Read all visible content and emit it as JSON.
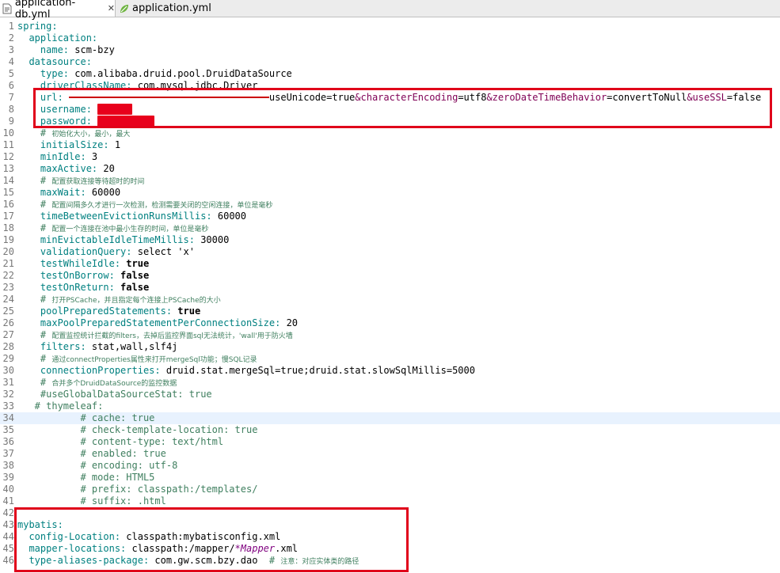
{
  "tabs": [
    {
      "label": "application-db.yml",
      "active": true,
      "closable": true,
      "icon": "yaml-file-icon"
    },
    {
      "label": "application.yml",
      "active": false,
      "icon": "spring-leaf-icon"
    }
  ],
  "lines": [
    {
      "n": "1",
      "tokens": [
        {
          "t": "spring:",
          "s": "k"
        }
      ]
    },
    {
      "n": "2",
      "tokens": [
        {
          "t": "  application:",
          "s": "k"
        }
      ]
    },
    {
      "n": "3",
      "tokens": [
        {
          "t": "    name: ",
          "s": "k"
        },
        {
          "t": "scm-bzy",
          "s": "v"
        }
      ]
    },
    {
      "n": "4",
      "tokens": [
        {
          "t": "  datasource:",
          "s": "k"
        }
      ]
    },
    {
      "n": "5",
      "tokens": [
        {
          "t": "    type: ",
          "s": "k"
        },
        {
          "t": "com.alibaba.druid.pool.DruidDataSource",
          "s": "v"
        }
      ]
    },
    {
      "n": "6",
      "tokens": [
        {
          "t": "    driverClassName: ",
          "s": "k"
        },
        {
          "t": "com.mysql.jdbc.Driver",
          "s": "v"
        }
      ]
    },
    {
      "n": "7",
      "tokens": [
        {
          "t": "    url: ",
          "s": "k"
        },
        {
          "t": "jdbc:mysql://xxxxxxxxxxxxxxxxxxxxx?",
          "s": "redactline"
        },
        {
          "t": "useUnicode=true",
          "s": "v"
        },
        {
          "t": "&characterEncoding",
          "s": "p"
        },
        {
          "t": "=utf8",
          "s": "v"
        },
        {
          "t": "&zeroDateTimeBehavior",
          "s": "p"
        },
        {
          "t": "=convertToNull",
          "s": "v"
        },
        {
          "t": "&useSSL",
          "s": "p"
        },
        {
          "t": "=false",
          "s": "v"
        }
      ]
    },
    {
      "n": "8",
      "tokens": [
        {
          "t": "    username: ",
          "s": "k"
        },
        {
          "t": "xxxxxx",
          "s": "redact"
        }
      ]
    },
    {
      "n": "9",
      "tokens": [
        {
          "t": "    password: ",
          "s": "k"
        },
        {
          "t": "xxxxxxxxxx",
          "s": "redact"
        }
      ]
    },
    {
      "n": "10",
      "tokens": [
        {
          "t": "    # ",
          "s": "c"
        },
        {
          "t": "初始化大小，最小，最大",
          "s": "cs"
        }
      ]
    },
    {
      "n": "11",
      "tokens": [
        {
          "t": "    initialSize: ",
          "s": "k"
        },
        {
          "t": "1",
          "s": "v"
        }
      ]
    },
    {
      "n": "12",
      "tokens": [
        {
          "t": "    minIdle: ",
          "s": "k"
        },
        {
          "t": "3",
          "s": "v"
        }
      ]
    },
    {
      "n": "13",
      "tokens": [
        {
          "t": "    maxActive: ",
          "s": "k"
        },
        {
          "t": "20",
          "s": "v"
        }
      ]
    },
    {
      "n": "14",
      "tokens": [
        {
          "t": "    # ",
          "s": "c"
        },
        {
          "t": "配置获取连接等待超时的时间",
          "s": "cs"
        }
      ]
    },
    {
      "n": "15",
      "tokens": [
        {
          "t": "    maxWait: ",
          "s": "k"
        },
        {
          "t": "60000",
          "s": "v"
        }
      ]
    },
    {
      "n": "16",
      "tokens": [
        {
          "t": "    # ",
          "s": "c"
        },
        {
          "t": "配置间隔多久才进行一次检测，检测需要关闭的空闲连接，单位是毫秒",
          "s": "cs"
        }
      ]
    },
    {
      "n": "17",
      "tokens": [
        {
          "t": "    timeBetweenEvictionRunsMillis: ",
          "s": "k"
        },
        {
          "t": "60000",
          "s": "v"
        }
      ]
    },
    {
      "n": "18",
      "tokens": [
        {
          "t": "    # ",
          "s": "c"
        },
        {
          "t": "配置一个连接在池中最小生存的时间，单位是毫秒",
          "s": "cs"
        }
      ]
    },
    {
      "n": "19",
      "tokens": [
        {
          "t": "    minEvictableIdleTimeMillis: ",
          "s": "k"
        },
        {
          "t": "30000",
          "s": "v"
        }
      ]
    },
    {
      "n": "20",
      "tokens": [
        {
          "t": "    validationQuery: ",
          "s": "k"
        },
        {
          "t": "select 'x'",
          "s": "v"
        }
      ]
    },
    {
      "n": "21",
      "tokens": [
        {
          "t": "    testWhileIdle: ",
          "s": "k"
        },
        {
          "t": "true",
          "s": "b"
        }
      ]
    },
    {
      "n": "22",
      "tokens": [
        {
          "t": "    testOnBorrow: ",
          "s": "k"
        },
        {
          "t": "false",
          "s": "b"
        }
      ]
    },
    {
      "n": "23",
      "tokens": [
        {
          "t": "    testOnReturn: ",
          "s": "k"
        },
        {
          "t": "false",
          "s": "b"
        }
      ]
    },
    {
      "n": "24",
      "tokens": [
        {
          "t": "    # ",
          "s": "c"
        },
        {
          "t": "打开PSCache，并且指定每个连接上PSCache的大小",
          "s": "cs"
        }
      ]
    },
    {
      "n": "25",
      "tokens": [
        {
          "t": "    poolPreparedStatements: ",
          "s": "k"
        },
        {
          "t": "true",
          "s": "b"
        }
      ]
    },
    {
      "n": "26",
      "tokens": [
        {
          "t": "    maxPoolPreparedStatementPerConnectionSize: ",
          "s": "k"
        },
        {
          "t": "20",
          "s": "v"
        }
      ]
    },
    {
      "n": "27",
      "tokens": [
        {
          "t": "    # ",
          "s": "c"
        },
        {
          "t": "配置监控统计拦截的filters，去掉后监控界面sql无法统计，'wall'用于防火墙",
          "s": "cs"
        }
      ]
    },
    {
      "n": "28",
      "tokens": [
        {
          "t": "    filters: ",
          "s": "k"
        },
        {
          "t": "stat,wall,slf4j",
          "s": "v"
        }
      ]
    },
    {
      "n": "29",
      "tokens": [
        {
          "t": "    # ",
          "s": "c"
        },
        {
          "t": "通过connectProperties属性来打开mergeSql功能；慢SQL记录",
          "s": "cs"
        }
      ]
    },
    {
      "n": "30",
      "tokens": [
        {
          "t": "    connectionProperties: ",
          "s": "k"
        },
        {
          "t": "druid.stat.mergeSql=true;druid.stat.slowSqlMillis=5000",
          "s": "v"
        }
      ]
    },
    {
      "n": "31",
      "tokens": [
        {
          "t": "    # ",
          "s": "c"
        },
        {
          "t": "合并多个DruidDataSource的监控数据",
          "s": "cs"
        }
      ]
    },
    {
      "n": "32",
      "tokens": [
        {
          "t": "    #useGlobalDataSourceStat: true",
          "s": "c"
        }
      ]
    },
    {
      "n": "33",
      "tokens": [
        {
          "t": "   # thymeleaf:",
          "s": "c"
        }
      ]
    },
    {
      "n": "34",
      "tokens": [
        {
          "t": "           # cache: true",
          "s": "c"
        }
      ],
      "hl": true
    },
    {
      "n": "35",
      "tokens": [
        {
          "t": "           # check-template-location: true",
          "s": "c"
        }
      ]
    },
    {
      "n": "36",
      "tokens": [
        {
          "t": "           # content-type: text/html",
          "s": "c"
        }
      ]
    },
    {
      "n": "37",
      "tokens": [
        {
          "t": "           # enabled: true",
          "s": "c"
        }
      ]
    },
    {
      "n": "38",
      "tokens": [
        {
          "t": "           # encoding: utf-8",
          "s": "c"
        }
      ]
    },
    {
      "n": "39",
      "tokens": [
        {
          "t": "           # mode: HTML5",
          "s": "c"
        }
      ]
    },
    {
      "n": "40",
      "tokens": [
        {
          "t": "           # prefix: classpath:/templates/",
          "s": "c"
        }
      ]
    },
    {
      "n": "41",
      "tokens": [
        {
          "t": "           # suffix: .html",
          "s": "c"
        }
      ]
    },
    {
      "n": "42",
      "tokens": []
    },
    {
      "n": "43",
      "tokens": [
        {
          "t": "mybatis:",
          "s": "k"
        }
      ]
    },
    {
      "n": "44",
      "tokens": [
        {
          "t": "  config-Location: ",
          "s": "k"
        },
        {
          "t": "classpath:mybatisconfig.xml",
          "s": "v"
        }
      ]
    },
    {
      "n": "45",
      "tokens": [
        {
          "t": "  mapper-locations: ",
          "s": "k"
        },
        {
          "t": "classpath:/mapper/",
          "s": "v"
        },
        {
          "t": "*Mapper",
          "s": "ital"
        },
        {
          "t": ".xml",
          "s": "v"
        }
      ]
    },
    {
      "n": "46",
      "tokens": [
        {
          "t": "  type-aliases-package: ",
          "s": "k"
        },
        {
          "t": "com.gw.scm.bzy.dao  ",
          "s": "v"
        },
        {
          "t": "# ",
          "s": "c"
        },
        {
          "t": "注意：对应实体类的路径",
          "s": "cs"
        }
      ]
    }
  ]
}
